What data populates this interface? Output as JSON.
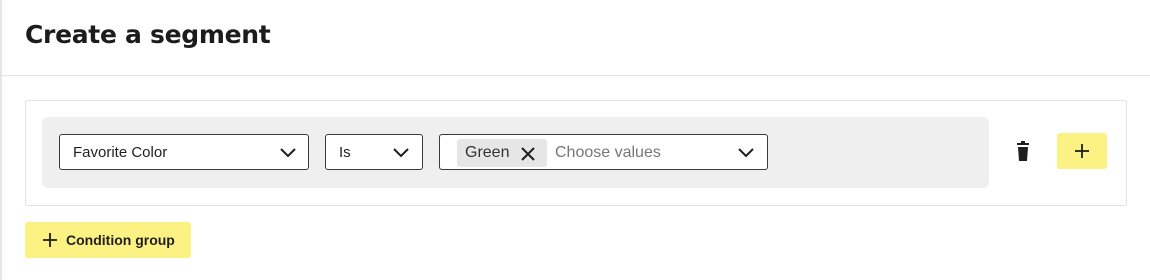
{
  "page": {
    "title": "Create a segment"
  },
  "condition": {
    "field": {
      "value": "Favorite Color"
    },
    "operator": {
      "value": "Is"
    },
    "values": {
      "chips": [
        "Green"
      ],
      "placeholder": "Choose values"
    }
  },
  "actions": {
    "add_condition_group_label": "Condition group"
  },
  "colors": {
    "accent_yellow": "#fbf283",
    "row_background": "#eeefee",
    "chip_background": "#e6e6e6"
  },
  "icons": {
    "chevron": "chevron-down-icon",
    "remove_chip": "close-icon",
    "delete": "trash-icon",
    "add": "plus-icon"
  }
}
